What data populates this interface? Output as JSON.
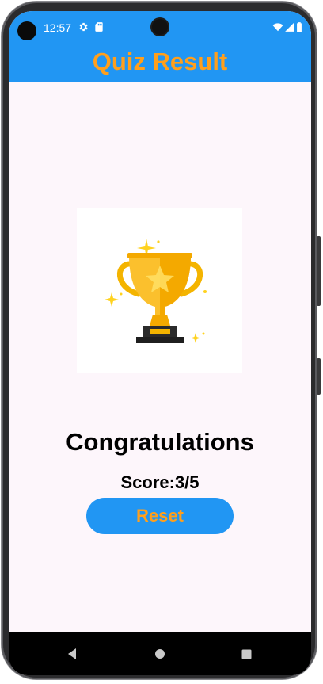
{
  "status_bar": {
    "time": "12:57",
    "left_icons": [
      "gear-icon",
      "sd-card-icon"
    ],
    "right_icons": [
      "wifi-icon",
      "cellular-signal-icon",
      "battery-icon"
    ]
  },
  "app_bar": {
    "title": "Quiz Result",
    "background_color": "#2196f3",
    "title_color": "#ff9f1c"
  },
  "result": {
    "image": "trophy-icon",
    "heading": "Congratulations",
    "score_text": "Score:3/5",
    "reset_label": "Reset"
  },
  "nav_bar": {
    "buttons": [
      "back-icon",
      "home-icon",
      "recents-icon"
    ]
  }
}
